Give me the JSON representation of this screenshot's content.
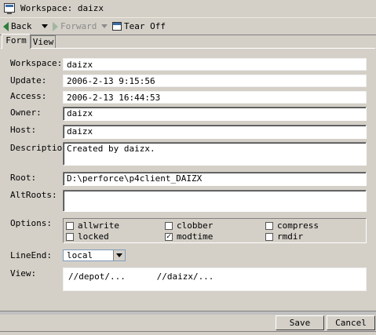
{
  "window": {
    "title": "Workspace: daizx"
  },
  "toolbar": {
    "back": "Back",
    "forward": "Forward",
    "tear_off": "Tear Off"
  },
  "tabs": [
    {
      "label": "Form",
      "active": true
    },
    {
      "label": "View",
      "active": false
    }
  ],
  "form": {
    "workspace": {
      "label": "Workspace:",
      "value": "daizx"
    },
    "update": {
      "label": "Update:",
      "value": "2006-2-13 9:15:56"
    },
    "access": {
      "label": "Access:",
      "value": "2006-2-13 16:44:53"
    },
    "owner": {
      "label": "Owner:",
      "value": "daizx"
    },
    "host": {
      "label": "Host:",
      "value": "daizx"
    },
    "description": {
      "label": "Description:",
      "value": "Created by daizx."
    },
    "root": {
      "label": "Root:",
      "value": "D:\\perforce\\p4client_DAIZX"
    },
    "altroots": {
      "label": "AltRoots:",
      "value": ""
    },
    "options": {
      "label": "Options:",
      "items": [
        {
          "label": "allwrite",
          "checked": false
        },
        {
          "label": "clobber",
          "checked": false
        },
        {
          "label": "compress",
          "checked": false
        },
        {
          "label": "locked",
          "checked": false
        },
        {
          "label": "modtime",
          "checked": true
        },
        {
          "label": "rmdir",
          "checked": false
        }
      ]
    },
    "lineend": {
      "label": "LineEnd:",
      "value": "local"
    },
    "view": {
      "label": "View:",
      "value": "//depot/...      //daizx/..."
    }
  },
  "buttons": {
    "save": "Save",
    "cancel": "Cancel"
  }
}
